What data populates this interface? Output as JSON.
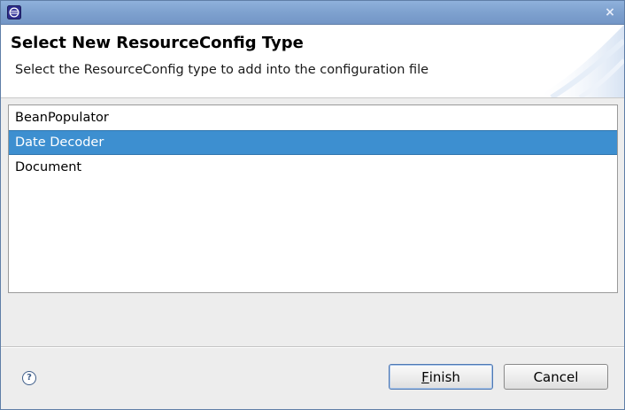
{
  "window": {
    "close_glyph": "×",
    "icon": "eclipse-app-icon"
  },
  "banner": {
    "title": "Select New ResourceConfig Type",
    "description": "Select the ResourceConfig type to add into the configuration file"
  },
  "list": {
    "items": [
      {
        "label": "BeanPopulator",
        "selected": false
      },
      {
        "label": "Date Decoder",
        "selected": true
      },
      {
        "label": "Document",
        "selected": false
      }
    ]
  },
  "footer": {
    "help_glyph": "?",
    "finish": {
      "mnemonic": "F",
      "rest": "inish"
    },
    "cancel_label": "Cancel"
  },
  "colors": {
    "titlebar": "#7ea1cf",
    "selection": "#3d8fd0",
    "dialog_bg": "#ededed"
  }
}
